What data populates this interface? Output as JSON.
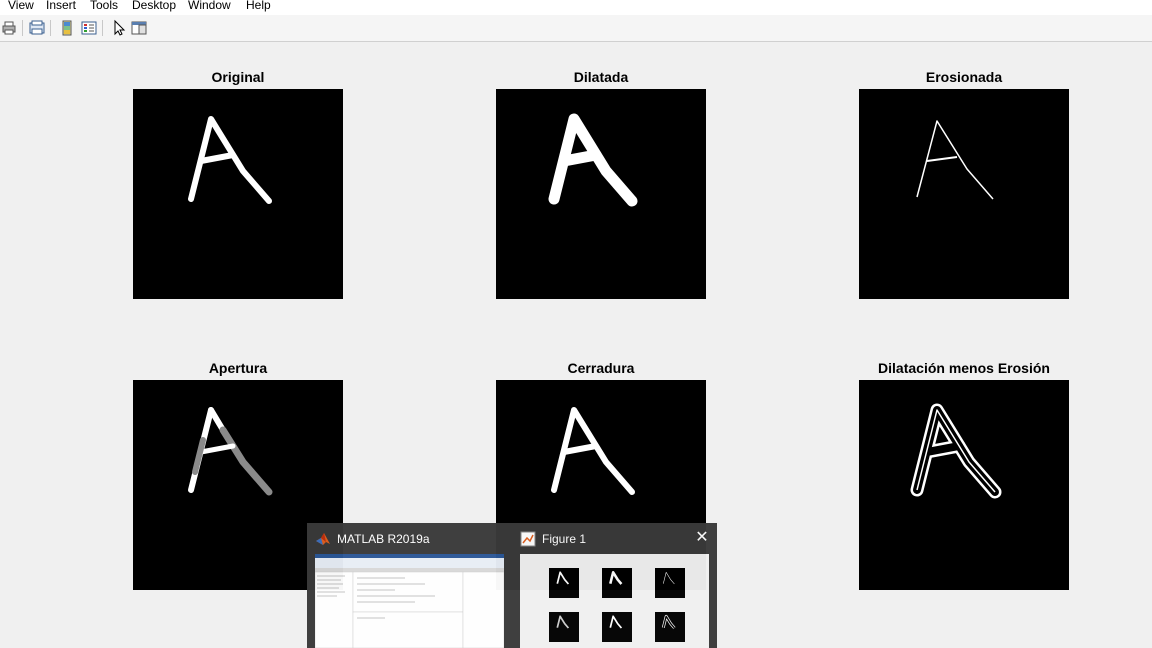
{
  "menu": {
    "items": [
      "View",
      "Insert",
      "Tools",
      "Desktop",
      "Window",
      "Help"
    ]
  },
  "toolbar": {
    "buttons": [
      "print-icon",
      "print-preview-icon",
      "colorbar-icon",
      "legend-icon",
      "pointer-icon",
      "property-editor-icon"
    ]
  },
  "figure": {
    "panels": [
      {
        "title": "Original"
      },
      {
        "title": "Dilatada"
      },
      {
        "title": "Erosionada"
      },
      {
        "title": "Apertura"
      },
      {
        "title": "Cerradura"
      },
      {
        "title": "Dilatación menos Erosión"
      }
    ]
  },
  "taskbar_preview": {
    "windows": [
      {
        "title": "MATLAB R2019a",
        "icon": "matlab-icon"
      },
      {
        "title": "Figure 1",
        "icon": "figure-icon"
      }
    ],
    "close_label": "✕"
  },
  "colors": {
    "background": "#f0f0f0",
    "image_bg": "#000000",
    "stroke": "#ffffff",
    "preview_bg": "#3a3a3a"
  }
}
